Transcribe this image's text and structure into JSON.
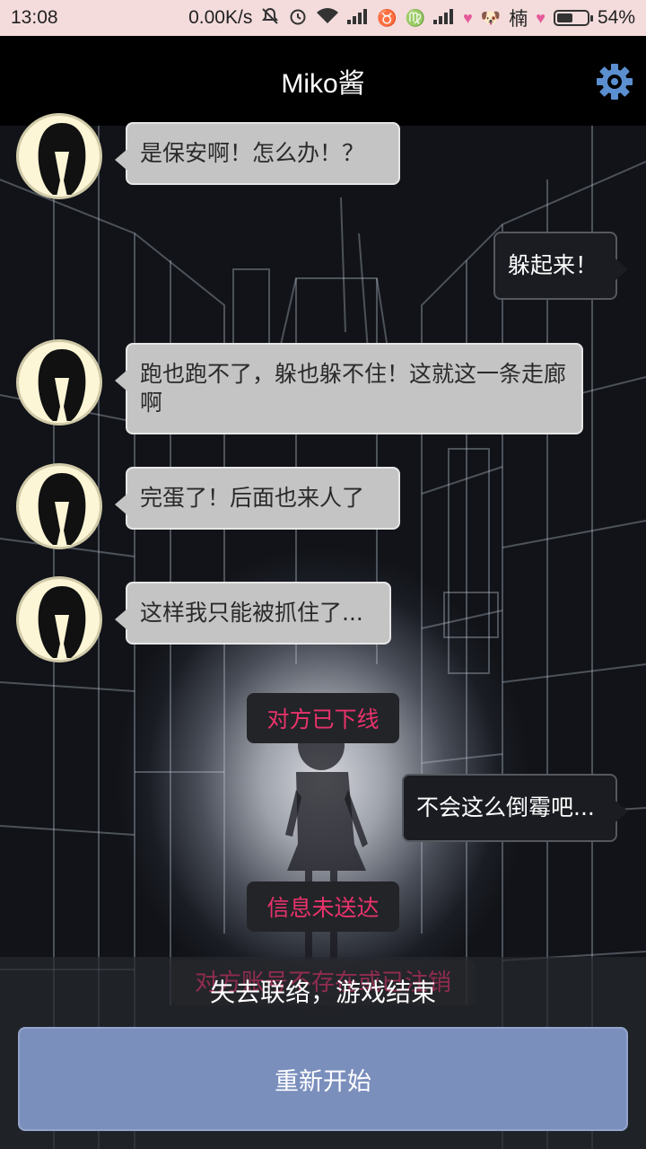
{
  "status_bar": {
    "time": "13:08",
    "network_speed": "0.00K/s",
    "user_name": "楠",
    "battery_percent": "54%",
    "battery_level": 0.54,
    "icons": [
      "mute-icon",
      "alarm-icon",
      "wifi-icon",
      "signal-icon",
      "taurus-icon",
      "virgo-icon",
      "signal-icon",
      "heart-icon",
      "dog-icon",
      "heart-icon",
      "battery-icon"
    ]
  },
  "header": {
    "title": "Miko酱",
    "settings_icon": "gear-icon"
  },
  "chat": {
    "messages": [
      {
        "from": "miko",
        "text": "是保安啊！怎么办！？"
      },
      {
        "from": "me",
        "text": "躲起来！"
      },
      {
        "from": "miko",
        "text": "跑也跑不了，躲也躲不住！这就这一条走廊啊"
      },
      {
        "from": "miko",
        "text": "完蛋了！后面也来人了"
      },
      {
        "from": "miko",
        "text": "这样我只能被抓住了..."
      },
      {
        "from": "system",
        "text": "对方已下线"
      },
      {
        "from": "me",
        "text": "不会这么倒霉吧..."
      },
      {
        "from": "system",
        "text": "信息未送达"
      },
      {
        "from": "system",
        "text": "对方账号不存在或已注销"
      }
    ]
  },
  "game_over": {
    "message": "失去联络，游戏结束",
    "restart_label": "重新开始"
  },
  "colors": {
    "system_text": "#e8336b",
    "restart_button": "#7b8fbd",
    "miko_bubble": "#c4c4c4",
    "my_bubble": "#1a1c22"
  }
}
